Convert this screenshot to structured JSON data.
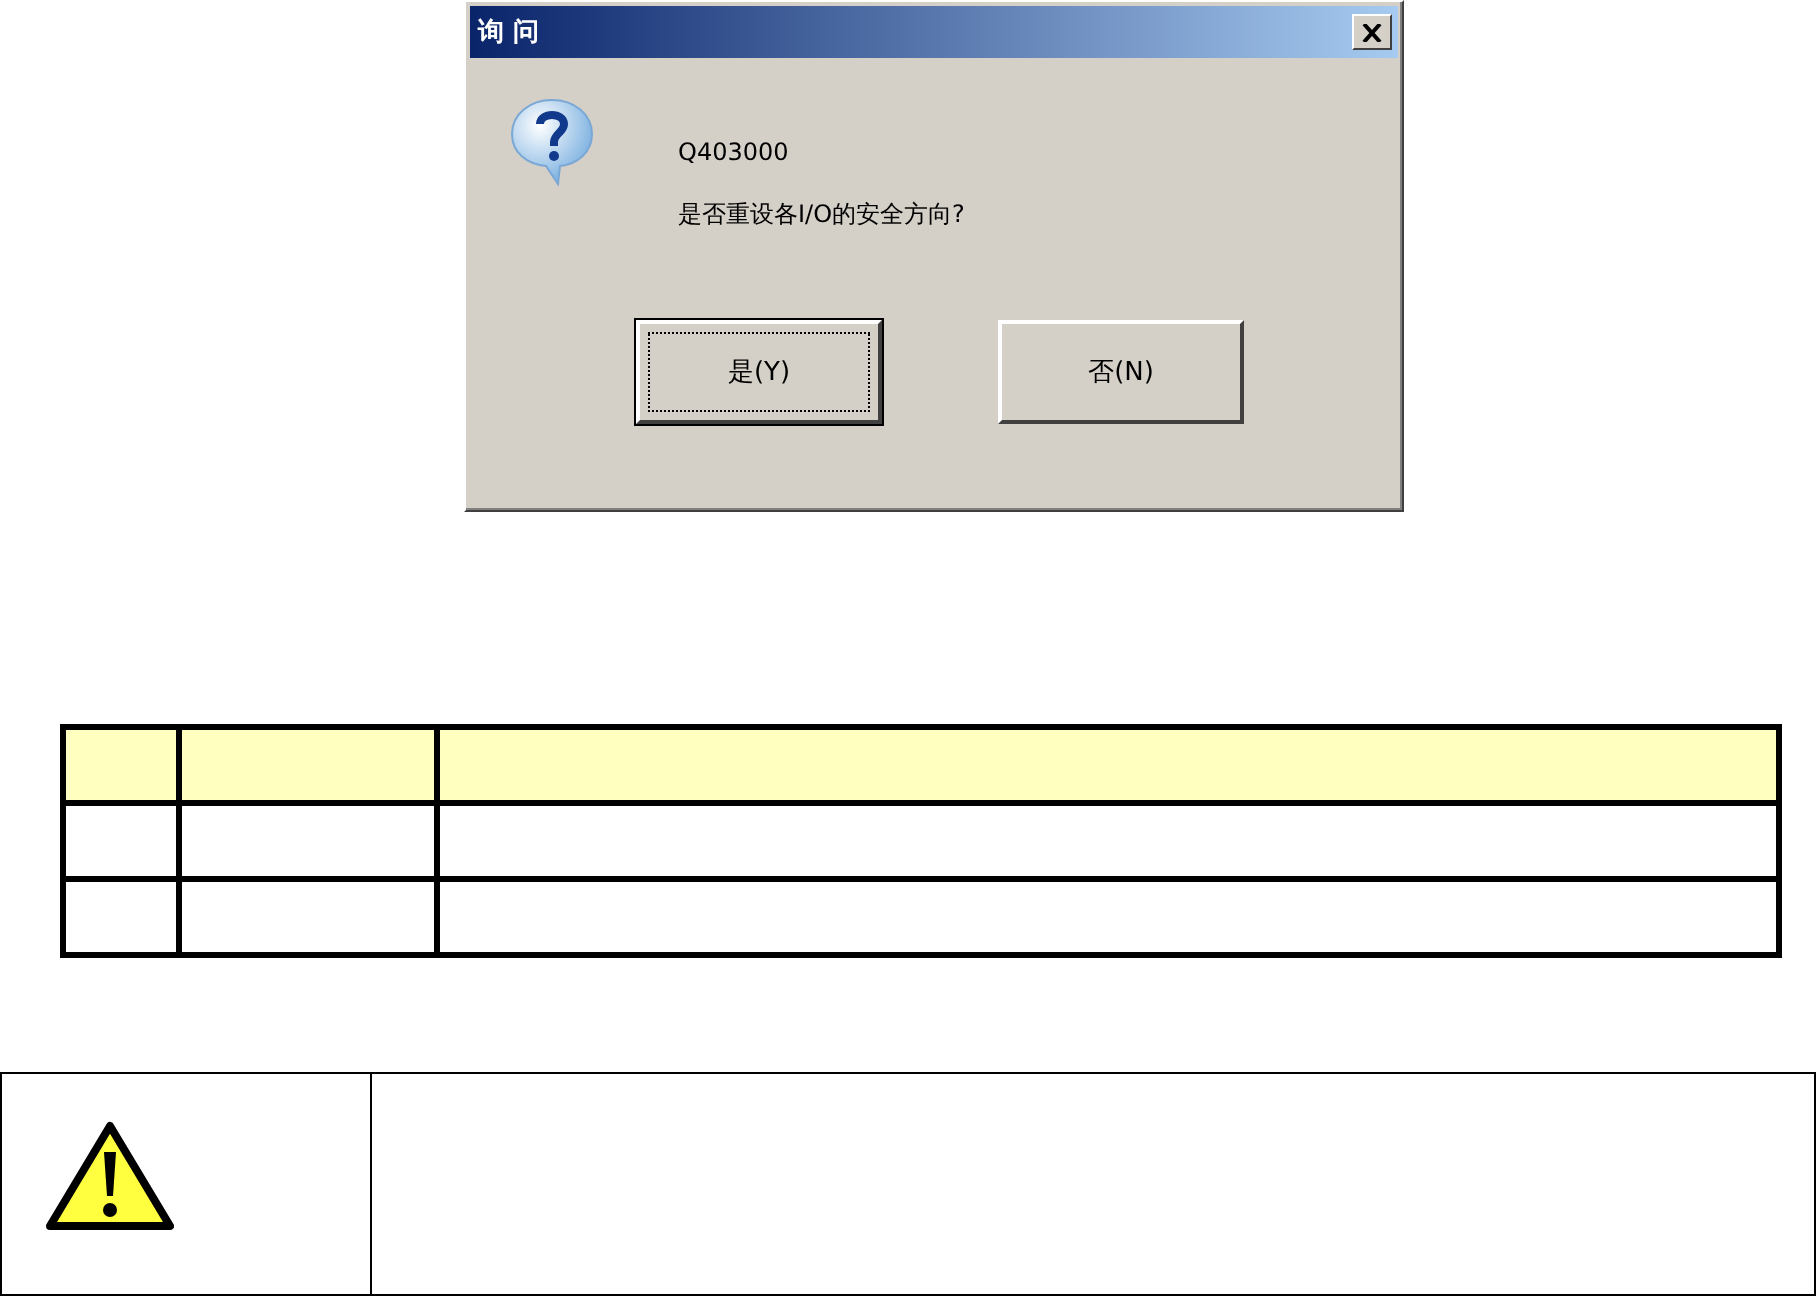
{
  "dialog": {
    "title": "询 问",
    "code": "Q403000",
    "message": "是否重设各I/O的安全方向?",
    "buttons": [
      {
        "label": "是(Y)",
        "default": true
      },
      {
        "label": "否(N)",
        "default": false
      }
    ]
  },
  "table": {
    "rows": [
      {
        "kind": "header"
      },
      {
        "kind": "body"
      },
      {
        "kind": "body"
      }
    ]
  },
  "notice": {
    "kind": "warning"
  }
}
